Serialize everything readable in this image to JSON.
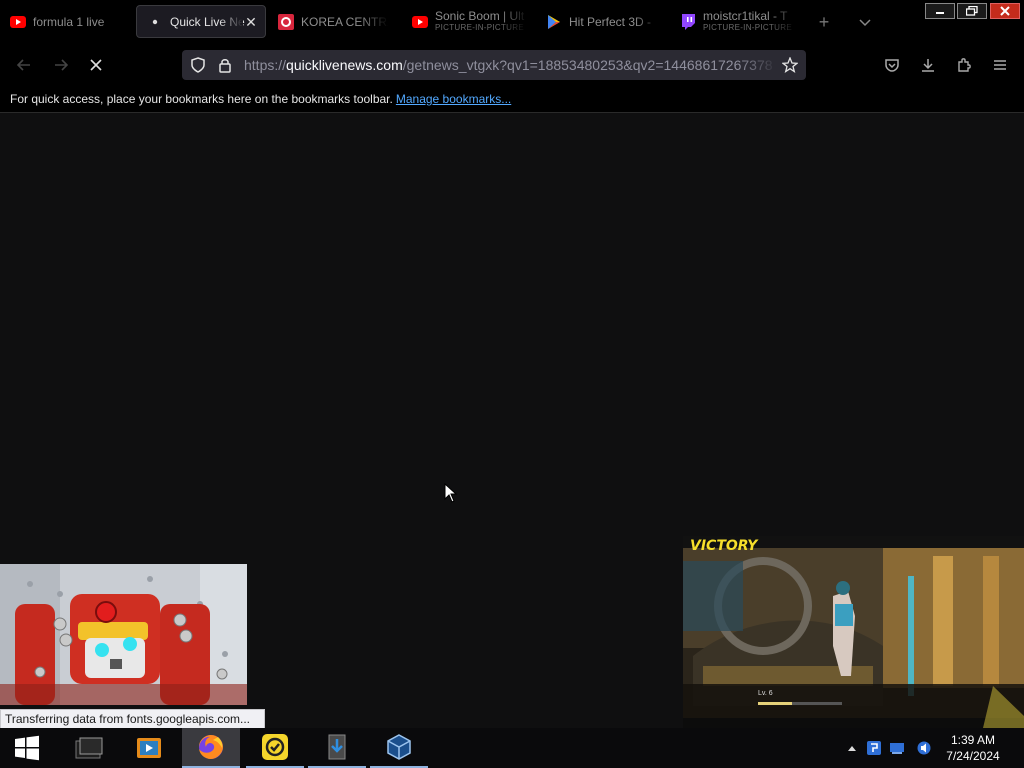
{
  "tabs": [
    {
      "title": "formula 1 live",
      "sub": "",
      "icon": "youtube-icon"
    },
    {
      "title": "Quick Live Ne",
      "sub": "",
      "icon": "dot-icon",
      "active": true
    },
    {
      "title": "KOREA CENTRA",
      "sub": "",
      "icon": "red-logo-icon"
    },
    {
      "title": "Sonic Boom | Ult",
      "sub": "PICTURE-IN-PICTURE",
      "icon": "youtube-icon"
    },
    {
      "title": "Hit Perfect 3D -",
      "sub": "",
      "icon": "play-store-icon"
    },
    {
      "title": "moistcr1tikal - T",
      "sub": "PICTURE-IN-PICTURE",
      "icon": "twitch-icon"
    }
  ],
  "url": {
    "scheme": "https://",
    "host": "quicklivenews.com",
    "path": "/getnews_vtgxk?qv1=18853480253&qv2=14468617267378"
  },
  "bookmarks": {
    "text": "For quick access, place your bookmarks here on the bookmarks toolbar.",
    "link": "Manage bookmarks..."
  },
  "pip": {
    "right_banner": "VICTORY",
    "right_level": "Lv. 6"
  },
  "status": "Transferring data from fonts.googleapis.com...",
  "clock": {
    "time": "1:39 AM",
    "date": "7/24/2024"
  },
  "colors": {
    "accent": "#53a9ff",
    "close": "#c42b1c",
    "victory": "#f6de2b"
  }
}
